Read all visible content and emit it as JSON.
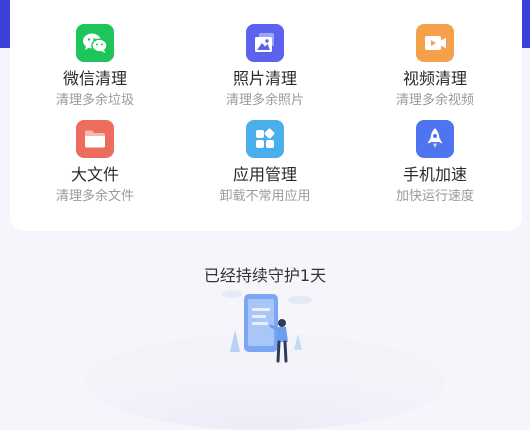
{
  "colors": {
    "header_blue": "#3b40d8",
    "wechat": "#1ec55a",
    "photo": "#5a62ee",
    "video": "#f5a14c",
    "files": "#ec6c5e",
    "apps": "#49aee9",
    "speed": "#4f74f0"
  },
  "tools": [
    {
      "title": "微信清理",
      "sub": "清理多余垃圾",
      "icon": "wechat-icon"
    },
    {
      "title": "照片清理",
      "sub": "清理多余照片",
      "icon": "photo-icon"
    },
    {
      "title": "视频清理",
      "sub": "清理多余视频",
      "icon": "video-icon"
    },
    {
      "title": "大文件",
      "sub": "清理多余文件",
      "icon": "folder-icon"
    },
    {
      "title": "应用管理",
      "sub": "卸载不常用应用",
      "icon": "apps-icon"
    },
    {
      "title": "手机加速",
      "sub": "加快运行速度",
      "icon": "rocket-icon"
    }
  ],
  "guard_text": "已经持续守护1天"
}
